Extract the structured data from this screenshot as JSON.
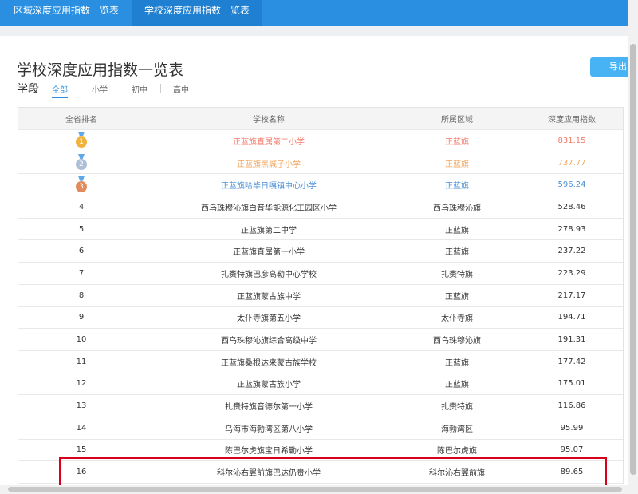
{
  "tabs": [
    {
      "label": "区域深度应用指数一览表"
    },
    {
      "label": "学校深度应用指数一览表"
    }
  ],
  "page_title": "学校深度应用指数一览表",
  "export_label": "导出",
  "filter": {
    "label": "学段",
    "options": [
      "全部",
      "小学",
      "初中",
      "高中"
    ],
    "selected": "全部"
  },
  "table": {
    "headers": [
      "全省排名",
      "学校名称",
      "所属区域",
      "深度应用指数"
    ],
    "rows": [
      {
        "rank": "1",
        "school": "正蓝旗直属第二小学",
        "region": "正蓝旗",
        "index": "831.15"
      },
      {
        "rank": "2",
        "school": "正蓝旗黑城子小学",
        "region": "正蓝旗",
        "index": "737.77"
      },
      {
        "rank": "3",
        "school": "正蓝旗哈毕日嘎镇中心小学",
        "region": "正蓝旗",
        "index": "596.24"
      },
      {
        "rank": "4",
        "school": "西乌珠穆沁旗白音华能源化工园区小学",
        "region": "西乌珠穆沁旗",
        "index": "528.46"
      },
      {
        "rank": "5",
        "school": "正蓝旗第二中学",
        "region": "正蓝旗",
        "index": "278.93"
      },
      {
        "rank": "6",
        "school": "正蓝旗直属第一小学",
        "region": "正蓝旗",
        "index": "237.22"
      },
      {
        "rank": "7",
        "school": "扎赉特旗巴彦高勒中心学校",
        "region": "扎赉特旗",
        "index": "223.29"
      },
      {
        "rank": "8",
        "school": "正蓝旗蒙古族中学",
        "region": "正蓝旗",
        "index": "217.17"
      },
      {
        "rank": "9",
        "school": "太仆寺旗第五小学",
        "region": "太仆寺旗",
        "index": "194.71"
      },
      {
        "rank": "10",
        "school": "西乌珠穆沁旗综合高级中学",
        "region": "西乌珠穆沁旗",
        "index": "191.31"
      },
      {
        "rank": "11",
        "school": "正蓝旗桑根达来蒙古族学校",
        "region": "正蓝旗",
        "index": "177.42"
      },
      {
        "rank": "12",
        "school": "正蓝旗蒙古族小学",
        "region": "正蓝旗",
        "index": "175.01"
      },
      {
        "rank": "13",
        "school": "扎赉特旗音德尔第一小学",
        "region": "扎赉特旗",
        "index": "116.86"
      },
      {
        "rank": "14",
        "school": "乌海市海勃湾区第八小学",
        "region": "海勃湾区",
        "index": "95.99"
      },
      {
        "rank": "15",
        "school": "陈巴尔虎旗宝日希勒小学",
        "region": "陈巴尔虎旗",
        "index": "95.07"
      },
      {
        "rank": "16",
        "school": "科尔沁右翼前旗巴达仍贵小学",
        "region": "科尔沁右翼前旗",
        "index": "89.65"
      }
    ]
  },
  "colors": {
    "tab_bar": "#2a8fe0",
    "active_filter": "#2a8fe0",
    "rank1_text": "#f47a6a",
    "rank2_text": "#f2a65e",
    "rank3_text": "#4a8fd6",
    "highlight_border": "#d9001b"
  }
}
